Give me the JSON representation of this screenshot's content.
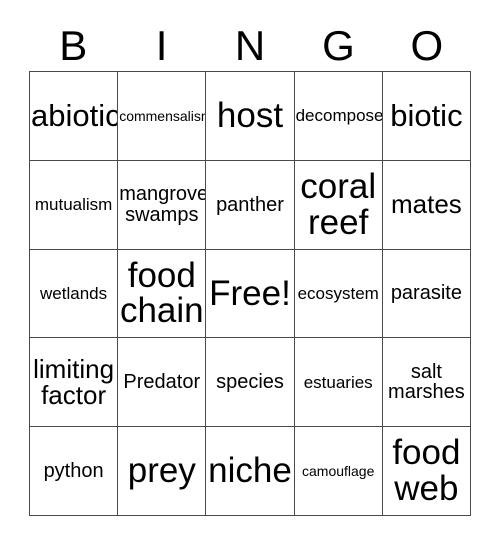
{
  "card": {
    "header_letters": [
      "B",
      "I",
      "N",
      "G",
      "O"
    ],
    "rows": [
      [
        {
          "text": "abiotic",
          "size": "xl"
        },
        {
          "text": "commensalism",
          "size": "xs"
        },
        {
          "text": "host",
          "size": "xxl"
        },
        {
          "text": "decomposer",
          "size": "s"
        },
        {
          "text": "biotic",
          "size": "xl"
        }
      ],
      [
        {
          "text": "mutualism",
          "size": "s"
        },
        {
          "text": "mangrove\nswamps",
          "size": "m"
        },
        {
          "text": "panther",
          "size": "m"
        },
        {
          "text": "coral\nreef",
          "size": "xxl"
        },
        {
          "text": "mates",
          "size": "l"
        }
      ],
      [
        {
          "text": "wetlands",
          "size": "s"
        },
        {
          "text": "food\nchain",
          "size": "xxl"
        },
        {
          "text": "Free!",
          "size": "xxl"
        },
        {
          "text": "ecosystem",
          "size": "s"
        },
        {
          "text": "parasite",
          "size": "m"
        }
      ],
      [
        {
          "text": "limiting\nfactor",
          "size": "l"
        },
        {
          "text": "Predator",
          "size": "m"
        },
        {
          "text": "species",
          "size": "m"
        },
        {
          "text": "estuaries",
          "size": "s"
        },
        {
          "text": "salt\nmarshes",
          "size": "m"
        }
      ],
      [
        {
          "text": "python",
          "size": "m"
        },
        {
          "text": "prey",
          "size": "xxl"
        },
        {
          "text": "niche",
          "size": "xxl"
        },
        {
          "text": "camouflage",
          "size": "xs"
        },
        {
          "text": "food\nweb",
          "size": "xxl"
        }
      ]
    ]
  }
}
